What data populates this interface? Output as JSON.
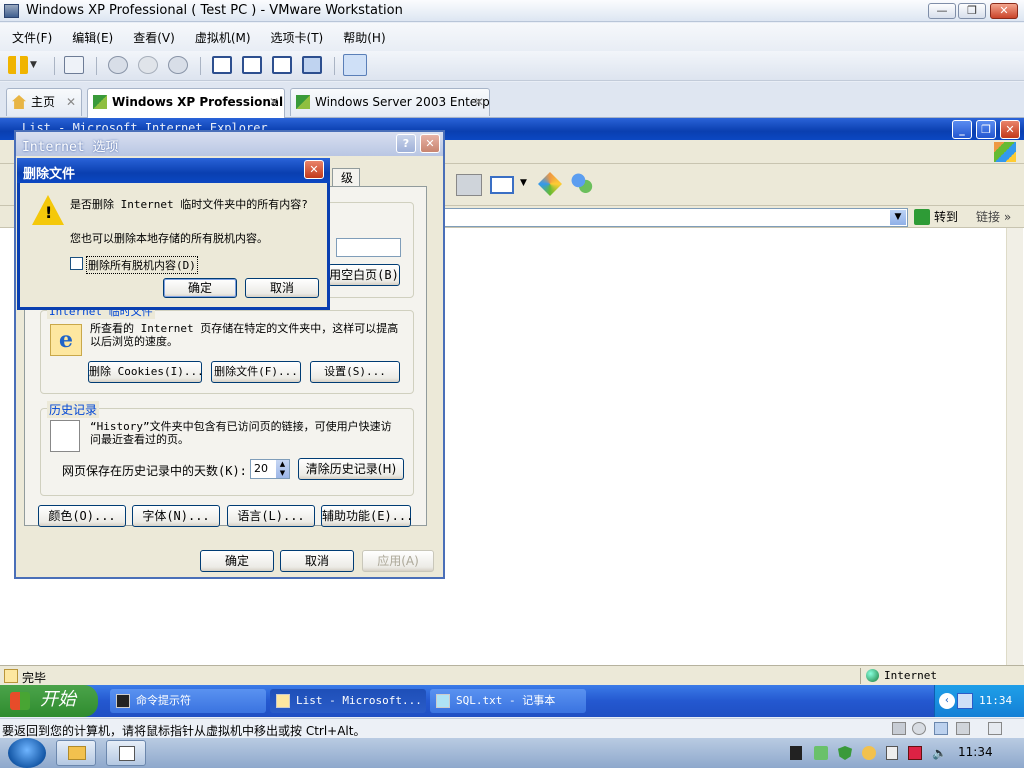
{
  "vm_window": {
    "title": "Windows XP Professional ( Test PC ) - VMware Workstation",
    "menu": [
      "文件(F)",
      "编辑(E)",
      "查看(V)",
      "虚拟机(M)",
      "选项卡(T)",
      "帮助(H)"
    ],
    "tabs": [
      {
        "label": "主页",
        "active": false
      },
      {
        "label": "Windows XP Professional...",
        "active": true
      },
      {
        "label": "Windows Server 2003 Enterpr...",
        "active": false
      }
    ]
  },
  "ie": {
    "title": "List - Microsoft Internet Explorer",
    "go_label": "转到",
    "links_label": "链接",
    "status_text": "完毕",
    "zone": "Internet"
  },
  "internet_options": {
    "title": "Internet 选项",
    "partial_button": "用空白页(B)",
    "temp_files": {
      "label": "Internet 临时文件",
      "desc": "所查看的 Internet 页存储在特定的文件夹中，这样可以提高以后浏览的速度。",
      "btn_cookies": "删除 Cookies(I)...",
      "btn_files": "删除文件(F)...",
      "btn_settings": "设置(S)..."
    },
    "history": {
      "label": "历史记录",
      "desc": "“History”文件夹中包含有已访问页的链接，可使用户快速访问最近查看过的页。",
      "days_label": "网页保存在历史记录中的天数(K):",
      "days_value": "20",
      "btn_clear": "清除历史记录(H)"
    },
    "bottom_buttons": [
      "颜色(O)...",
      "字体(N)...",
      "语言(L)...",
      "辅助功能(E)..."
    ],
    "ok": "确定",
    "cancel": "取消",
    "apply": "应用(A)"
  },
  "delete_dialog": {
    "title": "删除文件",
    "question": "是否删除 Internet 临时文件夹中的所有内容?",
    "info": "您也可以删除本地存储的所有脱机内容。",
    "checkbox_label": "删除所有脱机内容(D)",
    "checkbox_checked": false,
    "ok": "确定",
    "cancel": "取消"
  },
  "xp_taskbar": {
    "start_label": "开始",
    "tasks": [
      {
        "label": "命令提示符",
        "pressed": false
      },
      {
        "label": "List - Microsoft...",
        "pressed": true
      },
      {
        "label": "SQL.txt - 记事本",
        "pressed": false
      }
    ],
    "clock": "11:34"
  },
  "host": {
    "notice": "要返回到您的计算机，请将鼠标指针从虚拟机中移出或按 Ctrl+Alt。",
    "clock": "11:34"
  },
  "colors": {
    "xp_blue": "#0a3fb0",
    "xp_start_green": "#3a9a3a",
    "dialog_bg": "#ece9d8"
  }
}
